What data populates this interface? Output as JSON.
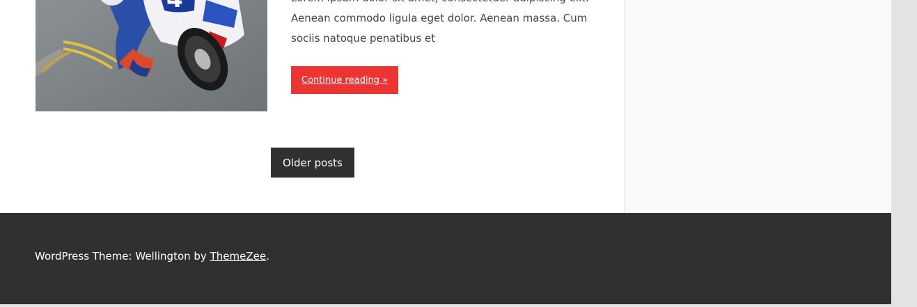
{
  "post": {
    "excerpt_line1": "Lorem ipsum dolor sit amet, consectetuer adipiscing elit.",
    "excerpt_line2": "Aenean commodo ligula eget dolor. Aenean massa. Cum",
    "excerpt_line3": "sociis natoque penatibus et",
    "continue_label": "Continue reading »"
  },
  "pagination": {
    "older_label": "Older posts"
  },
  "footer": {
    "credit_prefix": "WordPress Theme: Wellington by ",
    "credit_link": "ThemeZee",
    "credit_suffix": "."
  },
  "colors": {
    "accent": "#ee3333",
    "dark": "#303030",
    "sidebar_bg": "#f9f9f9"
  }
}
